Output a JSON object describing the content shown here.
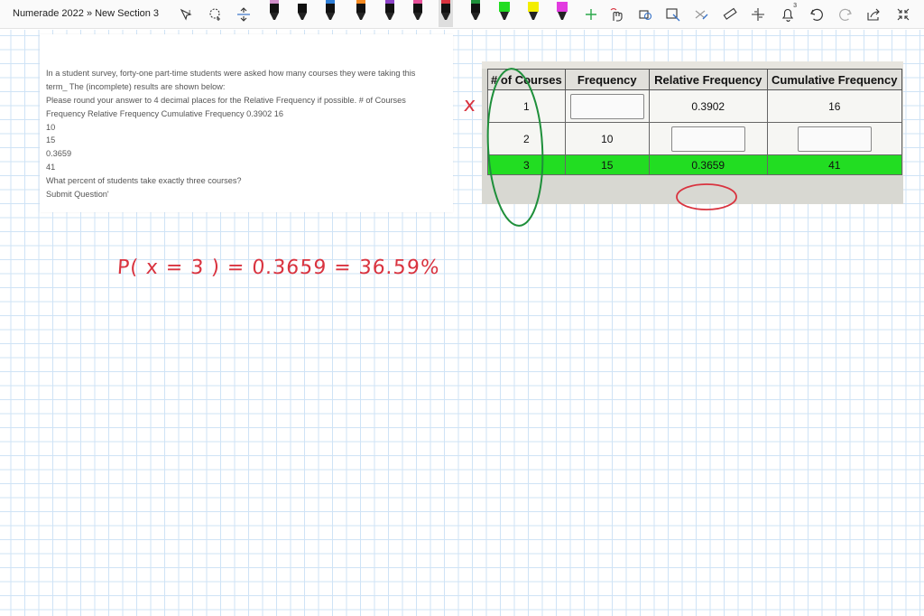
{
  "toolbar": {
    "title": "Numerade 2022 » New Section 3",
    "pens": [
      {
        "name": "pen-black-pink",
        "color": "#111111",
        "tip": "#d08ec8"
      },
      {
        "name": "pen-black",
        "color": "#111111",
        "tip": "#ffffff"
      },
      {
        "name": "pen-blue",
        "color": "#111111",
        "tip": "#2f7fd8"
      },
      {
        "name": "pen-orange",
        "color": "#111111",
        "tip": "#f58a21"
      },
      {
        "name": "pen-purple",
        "color": "#111111",
        "tip": "#8e44c9"
      },
      {
        "name": "pen-pink",
        "color": "#111111",
        "tip": "#e8519a"
      },
      {
        "name": "pen-red",
        "color": "#111111",
        "tip": "#d9333f"
      },
      {
        "name": "pen-green-dark",
        "color": "#111111",
        "tip": "#1e8f3a"
      },
      {
        "name": "highlighter-green",
        "color": "#22dd22",
        "tip": "#22dd22"
      },
      {
        "name": "highlighter-yellow",
        "color": "#f3ee00",
        "tip": "#f3ee00"
      },
      {
        "name": "highlighter-magenta",
        "color": "#e23be0",
        "tip": "#e23be0"
      }
    ],
    "colors": {
      "active_pen": "#d9333f"
    },
    "notification_count": "3"
  },
  "problem": {
    "lines": [
      "In a student survey, forty-one part-time students were asked how many courses they were taking this",
      "term_ The (incomplete) results are shown below:",
      "Please round your answer to 4 decimal places for the Relative Frequency if possible. # of Courses",
      "Frequency Relative Frequency Cumulative Frequency 0.3902 16",
      "10",
      "15",
      "0.3659",
      "41",
      "What percent of students take exactly three courses?",
      "Submit Question'"
    ]
  },
  "table": {
    "headers": [
      "# of Courses",
      "Frequency",
      "Relative Frequency",
      "Cumulative Frequency"
    ],
    "rows": [
      {
        "courses": "1",
        "frequency": "",
        "relative": "0.3902",
        "cumulative": "16"
      },
      {
        "courses": "2",
        "frequency": "10",
        "relative": "",
        "cumulative": ""
      },
      {
        "courses": "3",
        "frequency": "15",
        "relative": "0.3659",
        "cumulative": "41"
      }
    ],
    "highlight_color": "#22dd22"
  },
  "handwriting": {
    "x_mark": "x",
    "equation": "P( x = 3 ) = 0.3659 = 36.59%",
    "ink_red": "#d9333f",
    "ink_green": "#1e8f3a"
  }
}
